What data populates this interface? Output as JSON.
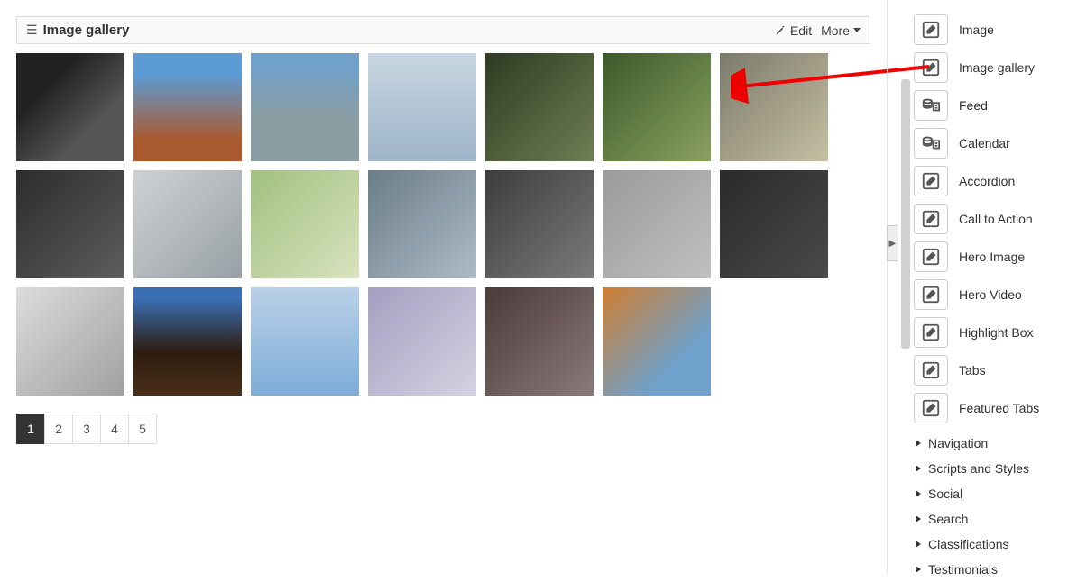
{
  "header": {
    "title": "Image gallery",
    "edit_label": "Edit",
    "more_label": "More"
  },
  "pagination": {
    "pages": [
      "1",
      "2",
      "3",
      "4",
      "5"
    ],
    "active_index": 0
  },
  "sidebar": {
    "widgets": [
      {
        "label": "Image",
        "icon": "edit"
      },
      {
        "label": "Image gallery",
        "icon": "edit"
      },
      {
        "label": "Feed",
        "icon": "feed"
      },
      {
        "label": "Calendar",
        "icon": "feed"
      },
      {
        "label": "Accordion",
        "icon": "edit"
      },
      {
        "label": "Call to Action",
        "icon": "edit"
      },
      {
        "label": "Hero Image",
        "icon": "edit"
      },
      {
        "label": "Hero Video",
        "icon": "edit"
      },
      {
        "label": "Highlight Box",
        "icon": "edit"
      },
      {
        "label": "Tabs",
        "icon": "edit"
      },
      {
        "label": "Featured Tabs",
        "icon": "edit"
      }
    ],
    "categories": [
      "Navigation",
      "Scripts and Styles",
      "Social",
      "Search",
      "Classifications",
      "Testimonials"
    ]
  }
}
